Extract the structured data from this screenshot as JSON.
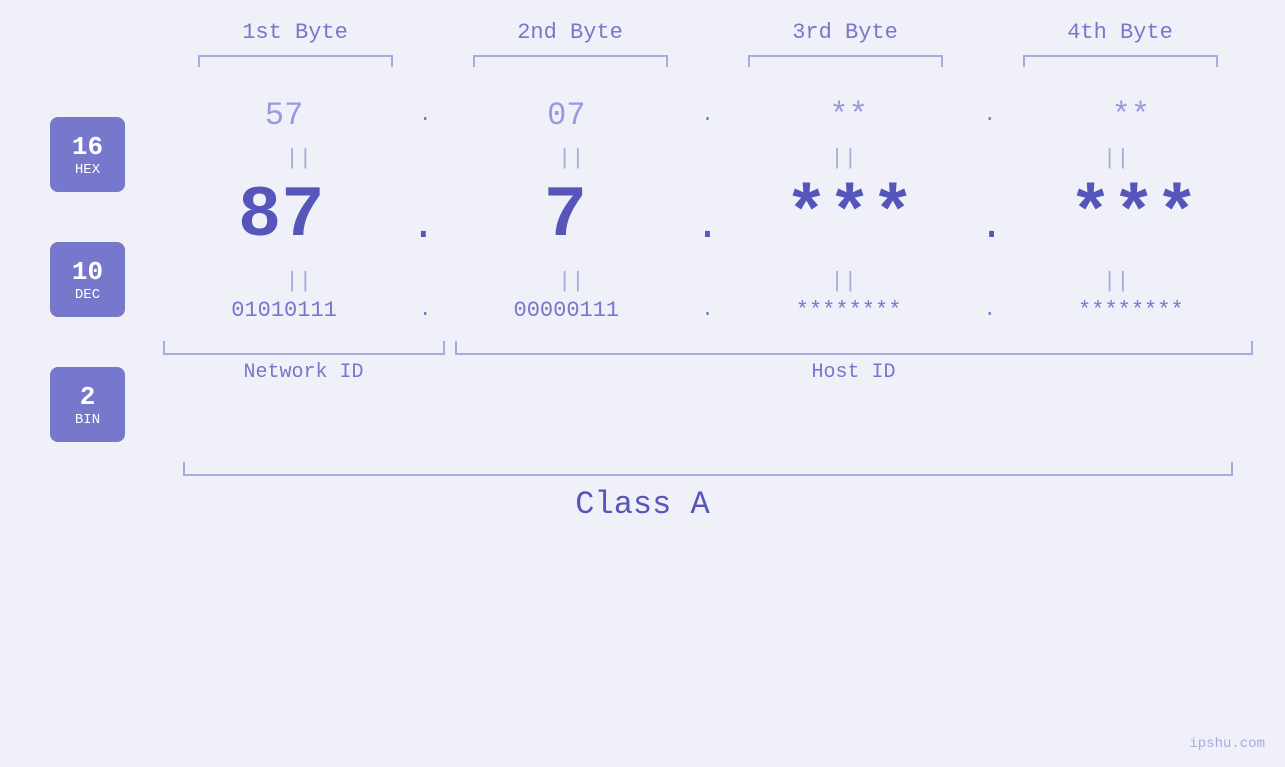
{
  "headers": {
    "byte1": "1st Byte",
    "byte2": "2nd Byte",
    "byte3": "3rd Byte",
    "byte4": "4th Byte"
  },
  "badges": {
    "hex": {
      "number": "16",
      "label": "HEX"
    },
    "dec": {
      "number": "10",
      "label": "DEC"
    },
    "bin": {
      "number": "2",
      "label": "BIN"
    }
  },
  "hex_row": {
    "byte1": "57",
    "dot1": ".",
    "byte2": "07",
    "dot2": ".",
    "byte3": "**",
    "dot3": ".",
    "byte4": "**"
  },
  "dec_row": {
    "byte1": "87",
    "dot1": ".",
    "byte2": "7",
    "dot2": ".",
    "byte3": "***",
    "dot3": ".",
    "byte4": "***"
  },
  "bin_row": {
    "byte1": "01010111",
    "dot1": ".",
    "byte2": "00000111",
    "dot2": ".",
    "byte3": "********",
    "dot3": ".",
    "byte4": "********"
  },
  "labels": {
    "network_id": "Network ID",
    "host_id": "Host ID",
    "class": "Class A"
  },
  "watermark": "ipshu.com",
  "equals_symbol": "||"
}
